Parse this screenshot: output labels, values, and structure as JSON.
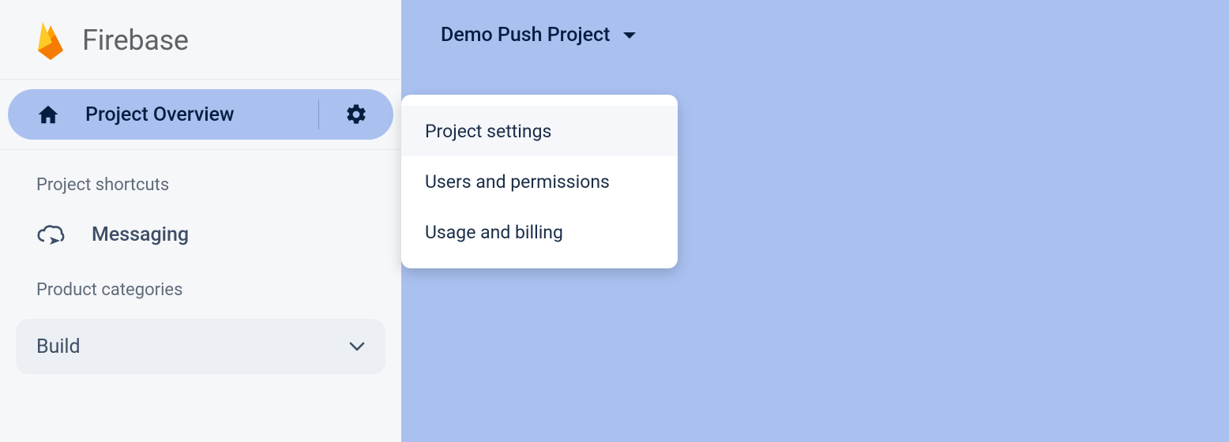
{
  "brand": {
    "wordmark": "Firebase"
  },
  "sidebar": {
    "project_overview_label": "Project Overview",
    "shortcuts_heading": "Project shortcuts",
    "shortcut_items": [
      {
        "label": "Messaging"
      }
    ],
    "categories_heading": "Product categories",
    "categories": [
      {
        "label": "Build"
      }
    ]
  },
  "header": {
    "project_name": "Demo Push Project"
  },
  "settings_menu": {
    "items": [
      {
        "label": "Project settings"
      },
      {
        "label": "Users and permissions"
      },
      {
        "label": "Usage and billing"
      }
    ]
  }
}
